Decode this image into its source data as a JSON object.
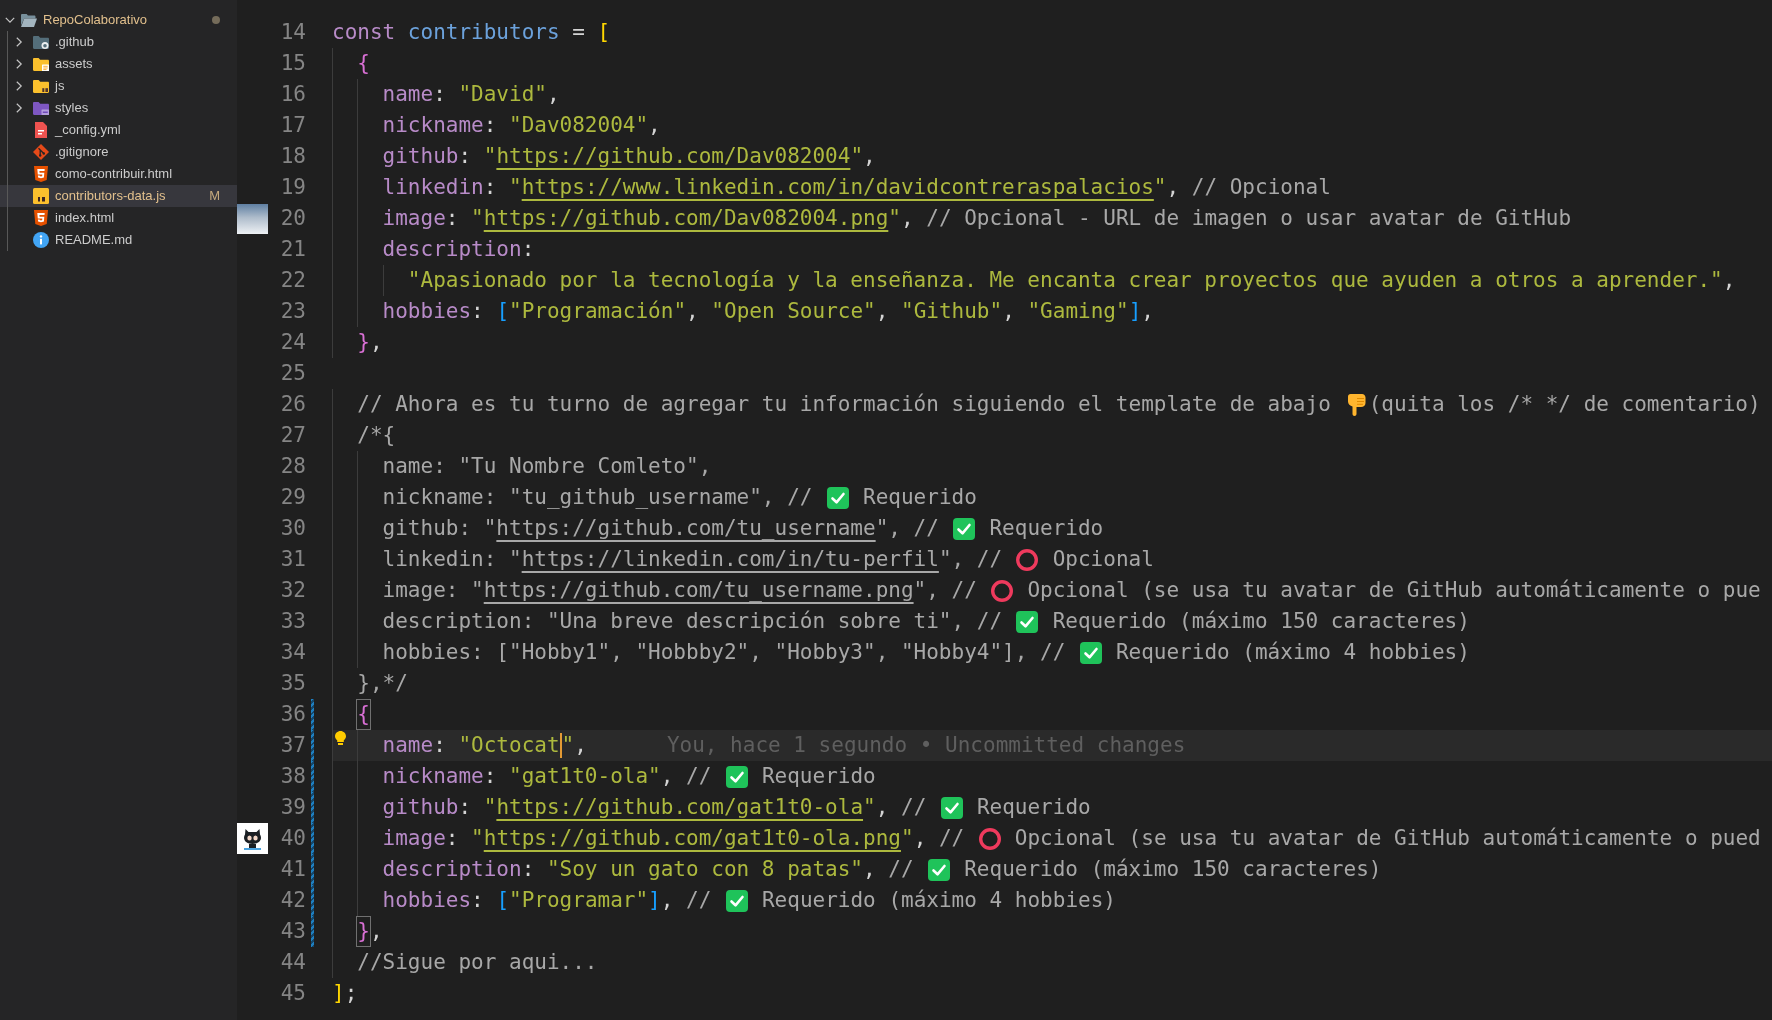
{
  "sidebar": {
    "tree": [
      {
        "label": "RepoColaborativo",
        "kind": "folder",
        "expanded": true,
        "selected": false,
        "modified": true,
        "children": [
          {
            "label": ".github",
            "kind": "github_folder",
            "expanded": false,
            "selected": false,
            "modified": false
          },
          {
            "label": "assets",
            "kind": "assets_folder",
            "expanded": false,
            "selected": false,
            "modified": false
          },
          {
            "label": "js",
            "kind": "js_folder",
            "expanded": false,
            "selected": false,
            "modified": false
          },
          {
            "label": "styles",
            "kind": "css_folder",
            "expanded": false,
            "selected": false,
            "modified": false
          },
          {
            "label": "_config.yml",
            "kind": "yaml_file",
            "selected": false,
            "modified": false
          },
          {
            "label": ".gitignore",
            "kind": "git_file",
            "selected": false,
            "modified": false
          },
          {
            "label": "como-contribuir.html",
            "kind": "html_file",
            "selected": false,
            "modified": false
          },
          {
            "label": "contributors-data.js",
            "kind": "js_file",
            "selected": true,
            "modified": true,
            "status": "M"
          },
          {
            "label": "index.html",
            "kind": "html_file",
            "selected": false,
            "modified": false
          },
          {
            "label": "README.md",
            "kind": "info_file",
            "selected": false,
            "modified": false
          }
        ]
      }
    ]
  },
  "editor": {
    "lines": [
      {
        "number": "14",
        "current": false,
        "changed": false,
        "tokens": [
          {
            "kind": "keyword",
            "text": "const "
          },
          {
            "kind": "variable",
            "text": "contributors"
          },
          {
            "kind": "punct",
            "text": " = "
          },
          {
            "kind": "bracket_outer",
            "text": "["
          }
        ]
      },
      {
        "number": "15",
        "current": false,
        "changed": false,
        "tokens": [
          {
            "kind": "bracket_object",
            "text": "  {"
          }
        ]
      },
      {
        "number": "16",
        "current": false,
        "changed": false,
        "tokens": [
          {
            "kind": "property",
            "text": "    name"
          },
          {
            "kind": "punct",
            "text": ": "
          },
          {
            "kind": "string",
            "text": "\"David\""
          },
          {
            "kind": "punct",
            "text": ","
          }
        ]
      },
      {
        "number": "17",
        "current": false,
        "changed": false,
        "tokens": [
          {
            "kind": "property",
            "text": "    nickname"
          },
          {
            "kind": "punct",
            "text": ": "
          },
          {
            "kind": "string",
            "text": "\"Dav082004\""
          },
          {
            "kind": "punct",
            "text": ","
          }
        ]
      },
      {
        "number": "18",
        "current": false,
        "changed": false,
        "tokens": [
          {
            "kind": "property",
            "text": "    github"
          },
          {
            "kind": "punct",
            "text": ": "
          },
          {
            "kind": "string",
            "text": "\""
          },
          {
            "kind": "url",
            "text": "https://github.com/Dav082004"
          },
          {
            "kind": "string",
            "text": "\""
          },
          {
            "kind": "punct",
            "text": ","
          }
        ]
      },
      {
        "number": "19",
        "current": false,
        "changed": false,
        "tokens": [
          {
            "kind": "property",
            "text": "    linkedin"
          },
          {
            "kind": "punct",
            "text": ": "
          },
          {
            "kind": "string",
            "text": "\""
          },
          {
            "kind": "url",
            "text": "https://www.linkedin.com/in/davidcontreraspalacios"
          },
          {
            "kind": "string",
            "text": "\""
          },
          {
            "kind": "punct",
            "text": ", "
          },
          {
            "kind": "comment",
            "text": "// Opcional"
          }
        ]
      },
      {
        "number": "20",
        "current": false,
        "changed": false,
        "gutter_image": {
          "kind": "photo"
        },
        "tokens": [
          {
            "kind": "property",
            "text": "    image"
          },
          {
            "kind": "punct",
            "text": ": "
          },
          {
            "kind": "string",
            "text": "\""
          },
          {
            "kind": "url",
            "text": "https://github.com/Dav082004.png"
          },
          {
            "kind": "string",
            "text": "\""
          },
          {
            "kind": "punct",
            "text": ", "
          },
          {
            "kind": "comment",
            "text": "// Opcional - URL de imagen o usar avatar de GitHub"
          }
        ]
      },
      {
        "number": "21",
        "current": false,
        "changed": false,
        "tokens": [
          {
            "kind": "property",
            "text": "    description"
          },
          {
            "kind": "punct",
            "text": ":"
          }
        ]
      },
      {
        "number": "22",
        "current": false,
        "changed": false,
        "tokens": [
          {
            "kind": "string",
            "text": "      \"Apasionado por la tecnología y la enseñanza. Me encanta crear proyectos que ayuden a otros a aprender.\""
          },
          {
            "kind": "punct",
            "text": ","
          }
        ]
      },
      {
        "number": "23",
        "current": false,
        "changed": false,
        "tokens": [
          {
            "kind": "property",
            "text": "    hobbies"
          },
          {
            "kind": "punct",
            "text": ": "
          },
          {
            "kind": "bracket_array",
            "text": "["
          },
          {
            "kind": "string",
            "text": "\"Programación\""
          },
          {
            "kind": "punct",
            "text": ", "
          },
          {
            "kind": "string",
            "text": "\"Open Source\""
          },
          {
            "kind": "punct",
            "text": ", "
          },
          {
            "kind": "string",
            "text": "\"Github\""
          },
          {
            "kind": "punct",
            "text": ", "
          },
          {
            "kind": "string",
            "text": "\"Gaming\""
          },
          {
            "kind": "bracket_array",
            "text": "]"
          },
          {
            "kind": "punct",
            "text": ","
          }
        ]
      },
      {
        "number": "24",
        "current": false,
        "changed": false,
        "tokens": [
          {
            "kind": "bracket_object",
            "text": "  }"
          },
          {
            "kind": "punct",
            "text": ","
          }
        ]
      },
      {
        "number": "25",
        "current": false,
        "changed": false
      },
      {
        "number": "26",
        "current": false,
        "changed": false,
        "tokens": [
          {
            "kind": "comment",
            "text": "  // Ahora es tu turno de agregar tu información siguiendo el template de abajo"
          },
          {
            "kind": "hand"
          },
          {
            "kind": "comment",
            "text": "(quita los /* */ de comentario)"
          }
        ]
      },
      {
        "number": "27",
        "current": false,
        "changed": false,
        "tokens": [
          {
            "kind": "comment",
            "text": "  /*{"
          }
        ]
      },
      {
        "number": "28",
        "current": false,
        "changed": false,
        "tokens": [
          {
            "kind": "comment",
            "text": "    name: \"Tu Nombre Comleto\","
          }
        ]
      },
      {
        "number": "29",
        "current": false,
        "changed": false,
        "tokens": [
          {
            "kind": "comment",
            "text": "    nickname: \"tu_github_username\", //"
          },
          {
            "kind": "check"
          },
          {
            "kind": "comment",
            "text": "Requerido"
          }
        ]
      },
      {
        "number": "30",
        "current": false,
        "changed": false,
        "tokens": [
          {
            "kind": "comment",
            "text": "    github: \""
          },
          {
            "kind": "comment_url",
            "text": "https://github.com/tu_username"
          },
          {
            "kind": "comment",
            "text": "\", //"
          },
          {
            "kind": "check"
          },
          {
            "kind": "comment",
            "text": "Requerido"
          }
        ]
      },
      {
        "number": "31",
        "current": false,
        "changed": false,
        "tokens": [
          {
            "kind": "comment",
            "text": "    linkedin: \""
          },
          {
            "kind": "comment_url",
            "text": "https://linkedin.com/in/tu-perfil"
          },
          {
            "kind": "comment",
            "text": "\", //"
          },
          {
            "kind": "circle"
          },
          {
            "kind": "comment",
            "text": "Opcional"
          }
        ]
      },
      {
        "number": "32",
        "current": false,
        "changed": false,
        "tokens": [
          {
            "kind": "comment",
            "text": "    image: \""
          },
          {
            "kind": "comment_url",
            "text": "https://github.com/tu_username.png"
          },
          {
            "kind": "comment",
            "text": "\", //"
          },
          {
            "kind": "circle"
          },
          {
            "kind": "comment",
            "text": "Opcional (se usa tu avatar de GitHub automáticamente o pue"
          }
        ]
      },
      {
        "number": "33",
        "current": false,
        "changed": false,
        "tokens": [
          {
            "kind": "comment",
            "text": "    description: \"Una breve descripción sobre ti\", //"
          },
          {
            "kind": "check"
          },
          {
            "kind": "comment",
            "text": "Requerido (máximo 150 caracteres)"
          }
        ]
      },
      {
        "number": "34",
        "current": false,
        "changed": false,
        "tokens": [
          {
            "kind": "comment",
            "text": "    hobbies: [\"Hobby1\", \"Hobbby2\", \"Hobby3\", \"Hobby4\"], //"
          },
          {
            "kind": "check"
          },
          {
            "kind": "comment",
            "text": "Requerido (máximo 4 hobbies)"
          }
        ]
      },
      {
        "number": "35",
        "current": false,
        "changed": false,
        "tokens": [
          {
            "kind": "comment",
            "text": "  },*/"
          }
        ]
      },
      {
        "number": "36",
        "current": false,
        "changed": true,
        "tokens": [
          {
            "kind": "bracket_match",
            "text": "  {"
          }
        ]
      },
      {
        "number": "37",
        "current": true,
        "changed": true,
        "tokens": [
          {
            "kind": "property",
            "text": "    name"
          },
          {
            "kind": "punct",
            "text": ": "
          },
          {
            "kind": "string",
            "text": "\"Octocat"
          },
          {
            "kind": "cursor"
          },
          {
            "kind": "string",
            "text": "\""
          },
          {
            "kind": "punct",
            "text": ","
          },
          {
            "kind": "blame",
            "text": "You, hace 1 segundo • Uncommitted changes"
          }
        ]
      },
      {
        "number": "38",
        "current": false,
        "changed": true,
        "tokens": [
          {
            "kind": "property",
            "text": "    nickname"
          },
          {
            "kind": "punct",
            "text": ": "
          },
          {
            "kind": "string",
            "text": "\"gat1t0-ola\""
          },
          {
            "kind": "punct",
            "text": ", "
          },
          {
            "kind": "comment",
            "text": "//"
          },
          {
            "kind": "check"
          },
          {
            "kind": "comment",
            "text": "Requerido"
          }
        ]
      },
      {
        "number": "39",
        "current": false,
        "changed": true,
        "tokens": [
          {
            "kind": "property",
            "text": "    github"
          },
          {
            "kind": "punct",
            "text": ": "
          },
          {
            "kind": "string",
            "text": "\""
          },
          {
            "kind": "url",
            "text": "https://github.com/gat1t0-ola"
          },
          {
            "kind": "string",
            "text": "\""
          },
          {
            "kind": "punct",
            "text": ", "
          },
          {
            "kind": "comment",
            "text": "//"
          },
          {
            "kind": "check"
          },
          {
            "kind": "comment",
            "text": "Requerido"
          }
        ]
      },
      {
        "number": "40",
        "current": false,
        "changed": true,
        "gutter_image": {
          "kind": "avatar"
        },
        "tokens": [
          {
            "kind": "property",
            "text": "    image"
          },
          {
            "kind": "punct",
            "text": ": "
          },
          {
            "kind": "string",
            "text": "\""
          },
          {
            "kind": "url",
            "text": "https://github.com/gat1t0-ola.png"
          },
          {
            "kind": "string",
            "text": "\""
          },
          {
            "kind": "punct",
            "text": ", "
          },
          {
            "kind": "comment",
            "text": "//"
          },
          {
            "kind": "circle"
          },
          {
            "kind": "comment",
            "text": "Opcional (se usa tu avatar de GitHub automáticamente o pued"
          }
        ]
      },
      {
        "number": "41",
        "current": false,
        "changed": true,
        "tokens": [
          {
            "kind": "property",
            "text": "    description"
          },
          {
            "kind": "punct",
            "text": ": "
          },
          {
            "kind": "string",
            "text": "\"Soy un gato con 8 patas\""
          },
          {
            "kind": "punct",
            "text": ", "
          },
          {
            "kind": "comment",
            "text": "//"
          },
          {
            "kind": "check"
          },
          {
            "kind": "comment",
            "text": "Requerido (máximo 150 caracteres)"
          }
        ]
      },
      {
        "number": "42",
        "current": false,
        "changed": true,
        "tokens": [
          {
            "kind": "property",
            "text": "    hobbies"
          },
          {
            "kind": "punct",
            "text": ": "
          },
          {
            "kind": "bracket_array",
            "text": "["
          },
          {
            "kind": "string",
            "text": "\"Programar\""
          },
          {
            "kind": "bracket_array",
            "text": "]"
          },
          {
            "kind": "punct",
            "text": ", "
          },
          {
            "kind": "comment",
            "text": "//"
          },
          {
            "kind": "check"
          },
          {
            "kind": "comment",
            "text": "Requerido (máximo 4 hobbies)"
          }
        ]
      },
      {
        "number": "43",
        "current": false,
        "changed": true,
        "tokens": [
          {
            "kind": "bracket_match",
            "text": "  }"
          },
          {
            "kind": "punct",
            "text": ","
          }
        ]
      },
      {
        "number": "44",
        "current": false,
        "changed": false,
        "tokens": [
          {
            "kind": "comment",
            "text": "  //Sigue por aqui..."
          }
        ]
      },
      {
        "number": "45",
        "current": false,
        "changed": false,
        "tokens": [
          {
            "kind": "bracket_outer",
            "text": "]"
          },
          {
            "kind": "punct",
            "text": ";"
          }
        ]
      }
    ]
  }
}
